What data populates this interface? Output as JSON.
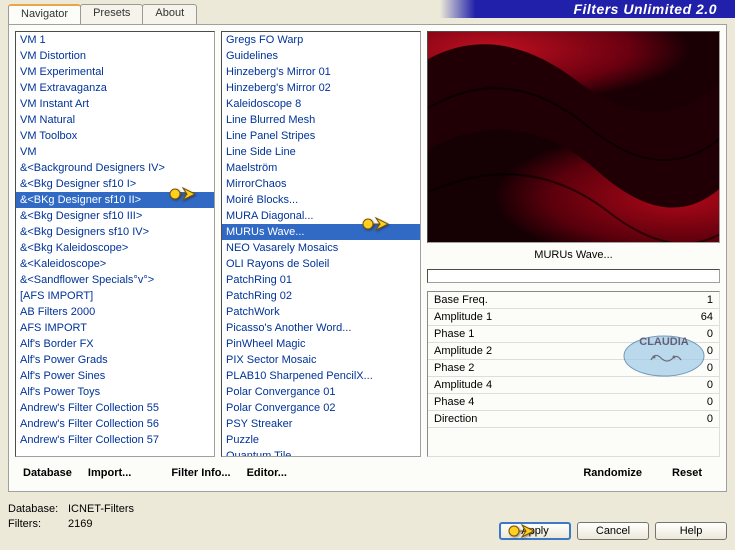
{
  "app_title": "Filters Unlimited 2.0",
  "tabs": [
    {
      "label": "Navigator",
      "active": true
    },
    {
      "label": "Presets",
      "active": false
    },
    {
      "label": "About",
      "active": false
    }
  ],
  "left_list": {
    "items": [
      "VM 1",
      "VM Distortion",
      "VM Experimental",
      "VM Extravaganza",
      "VM Instant Art",
      "VM Natural",
      "VM Toolbox",
      "VM",
      "&<Background Designers IV>",
      "&<Bkg Designer sf10 I>",
      "&<BKg Designer sf10 II>",
      "&<Bkg Designer sf10 III>",
      "&<Bkg Designers sf10 IV>",
      "&<Bkg Kaleidoscope>",
      "&<Kaleidoscope>",
      "&<Sandflower Specials°v°>",
      "[AFS IMPORT]",
      "AB Filters 2000",
      "AFS IMPORT",
      "Alf's Border FX",
      "Alf's Power Grads",
      "Alf's Power Sines",
      "Alf's Power Toys",
      "Andrew's Filter Collection 55",
      "Andrew's Filter Collection 56",
      "Andrew's Filter Collection 57"
    ],
    "selected_index": 10
  },
  "mid_list": {
    "items": [
      "Gregs FO Warp",
      "Guidelines",
      "Hinzeberg's Mirror 01",
      "Hinzeberg's Mirror 02",
      "Kaleidoscope 8",
      "Line Blurred Mesh",
      "Line Panel Stripes",
      "Line Side Line",
      "Maelström",
      "MirrorChaos",
      "Moiré Blocks...",
      "MURA Diagonal...",
      "MURUs Wave...",
      "NEO Vasarely Mosaics",
      "OLI Rayons de Soleil",
      "PatchRing 01",
      "PatchRing 02",
      "PatchWork",
      "Picasso's Another Word...",
      "PinWheel Magic",
      "PIX Sector Mosaic",
      "PLAB10 Sharpened PencilX...",
      "Polar Convergance 01",
      "Polar Convergance 02",
      "PSY Streaker",
      "Puzzle",
      "Quantum Tile"
    ],
    "selected_index": 12
  },
  "preview_label": "MURUs Wave...",
  "params": [
    {
      "name": "Base Freq.",
      "value": 1
    },
    {
      "name": "Amplitude 1",
      "value": 64
    },
    {
      "name": "Phase 1",
      "value": 0
    },
    {
      "name": "Amplitude 2",
      "value": 0
    },
    {
      "name": "Phase 2",
      "value": 0
    },
    {
      "name": "Amplitude 4",
      "value": 0
    },
    {
      "name": "Phase 4",
      "value": 0
    },
    {
      "name": "Direction",
      "value": 0
    }
  ],
  "buttons": {
    "database": "Database",
    "import": "Import...",
    "filter_info": "Filter Info...",
    "editor": "Editor...",
    "randomize": "Randomize",
    "reset": "Reset",
    "apply": "Apply",
    "cancel": "Cancel",
    "help": "Help"
  },
  "footer": {
    "db_label": "Database:",
    "db_value": "ICNET-Filters",
    "filters_label": "Filters:",
    "filters_value": "2169"
  },
  "watermark_text": "CLAUDIA"
}
